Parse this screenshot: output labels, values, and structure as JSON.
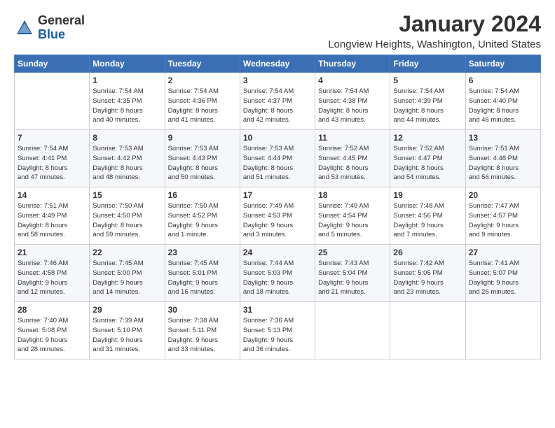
{
  "logo": {
    "general": "General",
    "blue": "Blue"
  },
  "title": "January 2024",
  "location": "Longview Heights, Washington, United States",
  "days_of_week": [
    "Sunday",
    "Monday",
    "Tuesday",
    "Wednesday",
    "Thursday",
    "Friday",
    "Saturday"
  ],
  "weeks": [
    [
      {
        "day": "",
        "info": ""
      },
      {
        "day": "1",
        "info": "Sunrise: 7:54 AM\nSunset: 4:35 PM\nDaylight: 8 hours\nand 40 minutes."
      },
      {
        "day": "2",
        "info": "Sunrise: 7:54 AM\nSunset: 4:36 PM\nDaylight: 8 hours\nand 41 minutes."
      },
      {
        "day": "3",
        "info": "Sunrise: 7:54 AM\nSunset: 4:37 PM\nDaylight: 8 hours\nand 42 minutes."
      },
      {
        "day": "4",
        "info": "Sunrise: 7:54 AM\nSunset: 4:38 PM\nDaylight: 8 hours\nand 43 minutes."
      },
      {
        "day": "5",
        "info": "Sunrise: 7:54 AM\nSunset: 4:39 PM\nDaylight: 8 hours\nand 44 minutes."
      },
      {
        "day": "6",
        "info": "Sunrise: 7:54 AM\nSunset: 4:40 PM\nDaylight: 8 hours\nand 46 minutes."
      }
    ],
    [
      {
        "day": "7",
        "info": "Sunrise: 7:54 AM\nSunset: 4:41 PM\nDaylight: 8 hours\nand 47 minutes."
      },
      {
        "day": "8",
        "info": "Sunrise: 7:53 AM\nSunset: 4:42 PM\nDaylight: 8 hours\nand 48 minutes."
      },
      {
        "day": "9",
        "info": "Sunrise: 7:53 AM\nSunset: 4:43 PM\nDaylight: 8 hours\nand 50 minutes."
      },
      {
        "day": "10",
        "info": "Sunrise: 7:53 AM\nSunset: 4:44 PM\nDaylight: 8 hours\nand 51 minutes."
      },
      {
        "day": "11",
        "info": "Sunrise: 7:52 AM\nSunset: 4:45 PM\nDaylight: 8 hours\nand 53 minutes."
      },
      {
        "day": "12",
        "info": "Sunrise: 7:52 AM\nSunset: 4:47 PM\nDaylight: 8 hours\nand 54 minutes."
      },
      {
        "day": "13",
        "info": "Sunrise: 7:51 AM\nSunset: 4:48 PM\nDaylight: 8 hours\nand 56 minutes."
      }
    ],
    [
      {
        "day": "14",
        "info": "Sunrise: 7:51 AM\nSunset: 4:49 PM\nDaylight: 8 hours\nand 58 minutes."
      },
      {
        "day": "15",
        "info": "Sunrise: 7:50 AM\nSunset: 4:50 PM\nDaylight: 8 hours\nand 59 minutes."
      },
      {
        "day": "16",
        "info": "Sunrise: 7:50 AM\nSunset: 4:52 PM\nDaylight: 9 hours\nand 1 minute."
      },
      {
        "day": "17",
        "info": "Sunrise: 7:49 AM\nSunset: 4:53 PM\nDaylight: 9 hours\nand 3 minutes."
      },
      {
        "day": "18",
        "info": "Sunrise: 7:49 AM\nSunset: 4:54 PM\nDaylight: 9 hours\nand 5 minutes."
      },
      {
        "day": "19",
        "info": "Sunrise: 7:48 AM\nSunset: 4:56 PM\nDaylight: 9 hours\nand 7 minutes."
      },
      {
        "day": "20",
        "info": "Sunrise: 7:47 AM\nSunset: 4:57 PM\nDaylight: 9 hours\nand 9 minutes."
      }
    ],
    [
      {
        "day": "21",
        "info": "Sunrise: 7:46 AM\nSunset: 4:58 PM\nDaylight: 9 hours\nand 12 minutes."
      },
      {
        "day": "22",
        "info": "Sunrise: 7:45 AM\nSunset: 5:00 PM\nDaylight: 9 hours\nand 14 minutes."
      },
      {
        "day": "23",
        "info": "Sunrise: 7:45 AM\nSunset: 5:01 PM\nDaylight: 9 hours\nand 16 minutes."
      },
      {
        "day": "24",
        "info": "Sunrise: 7:44 AM\nSunset: 5:03 PM\nDaylight: 9 hours\nand 18 minutes."
      },
      {
        "day": "25",
        "info": "Sunrise: 7:43 AM\nSunset: 5:04 PM\nDaylight: 9 hours\nand 21 minutes."
      },
      {
        "day": "26",
        "info": "Sunrise: 7:42 AM\nSunset: 5:05 PM\nDaylight: 9 hours\nand 23 minutes."
      },
      {
        "day": "27",
        "info": "Sunrise: 7:41 AM\nSunset: 5:07 PM\nDaylight: 9 hours\nand 26 minutes."
      }
    ],
    [
      {
        "day": "28",
        "info": "Sunrise: 7:40 AM\nSunset: 5:08 PM\nDaylight: 9 hours\nand 28 minutes."
      },
      {
        "day": "29",
        "info": "Sunrise: 7:39 AM\nSunset: 5:10 PM\nDaylight: 9 hours\nand 31 minutes."
      },
      {
        "day": "30",
        "info": "Sunrise: 7:38 AM\nSunset: 5:11 PM\nDaylight: 9 hours\nand 33 minutes."
      },
      {
        "day": "31",
        "info": "Sunrise: 7:36 AM\nSunset: 5:13 PM\nDaylight: 9 hours\nand 36 minutes."
      },
      {
        "day": "",
        "info": ""
      },
      {
        "day": "",
        "info": ""
      },
      {
        "day": "",
        "info": ""
      }
    ]
  ]
}
